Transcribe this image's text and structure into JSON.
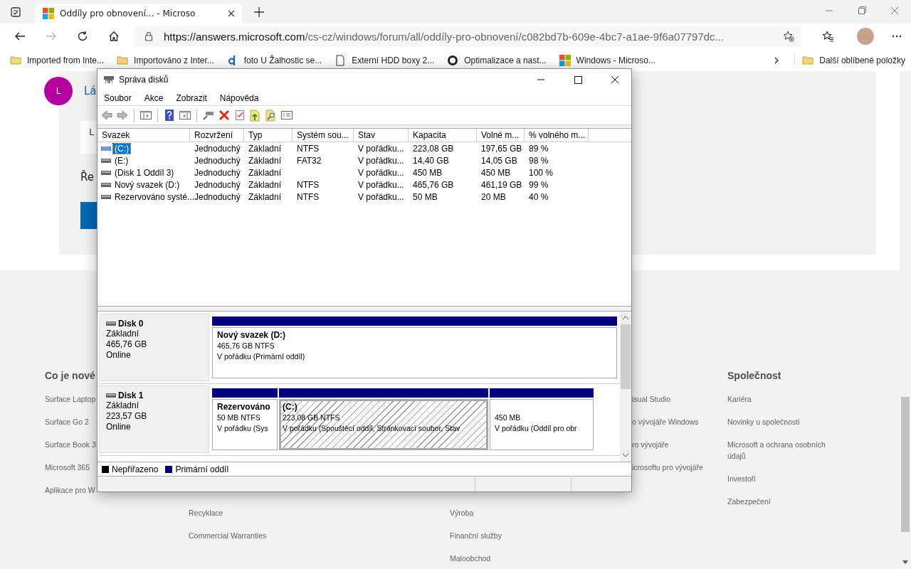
{
  "browser": {
    "tab_title": "Oddíly pro obnovení... - Microso",
    "url_host": "https://answers.microsoft.com",
    "url_path": "/cs-cz/windows/forum/all/oddíly-pro-obnovení/c082bd7b-609e-4bc7-a1ae-9f6a07797dc...",
    "favorites": [
      {
        "label": "Imported from Inte...",
        "kind": "folder"
      },
      {
        "label": "Importováno z Inter...",
        "kind": "folder"
      },
      {
        "label": "foto U Žalhostic se...",
        "kind": "letter"
      },
      {
        "label": "Externí HDD boxy 2...",
        "kind": "page"
      },
      {
        "label": "Optimalizace a nast...",
        "kind": "globe"
      },
      {
        "label": "Windows - Microso...",
        "kind": "logo"
      }
    ],
    "more_favorites": "Další oblíbené položky"
  },
  "page": {
    "post": {
      "avatar_initial": "L",
      "author": "Lá",
      "box_text": "L",
      "text": "Ře"
    },
    "footer": [
      {
        "heading": "Co je nové",
        "links": [
          "Surface Laptop",
          "Surface Go 2",
          "Surface Book 3",
          "Microsoft 365",
          "Aplikace pro W"
        ]
      },
      {
        "links": [
          "Recyklace",
          "Commercial Warranties"
        ]
      },
      {
        "links": [
          "Výroba",
          "Finanční služby",
          "Maloobchod"
        ]
      },
      {
        "links": [
          "isual Studio",
          "o vývojáře Windows",
          "ro vývojáře",
          "icrosoftu pro vývojáře"
        ]
      },
      {
        "heading": "Společnost",
        "links": [
          "Kariéra",
          "Novinky u společnosti",
          "Microsoft a ochrana osobních údajů",
          "Investoři",
          "Zabezpečení"
        ]
      }
    ]
  },
  "window": {
    "title": "Správa disků",
    "menu": [
      "Soubor",
      "Akce",
      "Zobrazit",
      "Nápověda"
    ],
    "columns": [
      "Svazek",
      "Rozvržení",
      "Typ",
      "Systém sou...",
      "Stav",
      "Kapacita",
      "Volné m...",
      "% volného m..."
    ],
    "rows": [
      {
        "volume": "(C:)",
        "layout": "Jednoduchý",
        "type": "Základní",
        "file_system": "NTFS",
        "status": "V pořádku...",
        "capacity": "223,08 GB",
        "free": "197,65 GB",
        "free_percent": "89 %",
        "selected": true
      },
      {
        "volume": "(E:)",
        "layout": "Jednoduchý",
        "type": "Základní",
        "file_system": "FAT32",
        "status": "V pořádku...",
        "capacity": "14,40 GB",
        "free": "14,05 GB",
        "free_percent": "98 %",
        "selected": false
      },
      {
        "volume": "(Disk 1 Oddíl 3)",
        "layout": "Jednoduchý",
        "type": "Základní",
        "status": "V pořádku...",
        "capacity": "450 MB",
        "free": "450 MB",
        "free_percent": "100 %",
        "selected": false
      },
      {
        "volume": "Nový svazek (D:)",
        "layout": "Jednoduchý",
        "type": "Základní",
        "file_system": "NTFS",
        "status": "V pořádku...",
        "capacity": "465,76 GB",
        "free": "461,19 GB",
        "free_percent": "99 %",
        "selected": false
      },
      {
        "volume": "Rezervováno systé...",
        "layout": "Jednoduchý",
        "type": "Základní",
        "file_system": "NTFS",
        "status": "V pořádku...",
        "capacity": "50 MB",
        "free": "20 MB",
        "free_percent": "40 %",
        "selected": false
      }
    ],
    "disks": [
      {
        "name": "Disk 0",
        "type": "Základní",
        "size": "465,76 GB",
        "status": "Online",
        "partitions": [
          {
            "name": "Nový svazek  (D:)",
            "size": "465,76 GB NTFS",
            "status": "V pořádku (Primární oddíl)",
            "selected": false
          }
        ]
      },
      {
        "name": "Disk 1",
        "type": "Základní",
        "size": "223,57 GB",
        "status": "Online",
        "partitions": [
          {
            "name": "Rezervováno",
            "size": "50 MB NTFS",
            "status": "V pořádku (Sys",
            "selected": false
          },
          {
            "name": "(C:)",
            "size": "223,08 GB NTFS",
            "status": "V pořádku (Spouštěcí oddíl, Stránkovací soubor, Stav",
            "selected": true
          },
          {
            "size": "450 MB",
            "status": "V pořádku (Oddíl pro obr",
            "selected": false
          }
        ]
      }
    ],
    "legend": [
      {
        "label": "Nepřiřazeno",
        "color": "#000000"
      },
      {
        "label": "Primární oddíl",
        "color": "#000080"
      }
    ]
  }
}
